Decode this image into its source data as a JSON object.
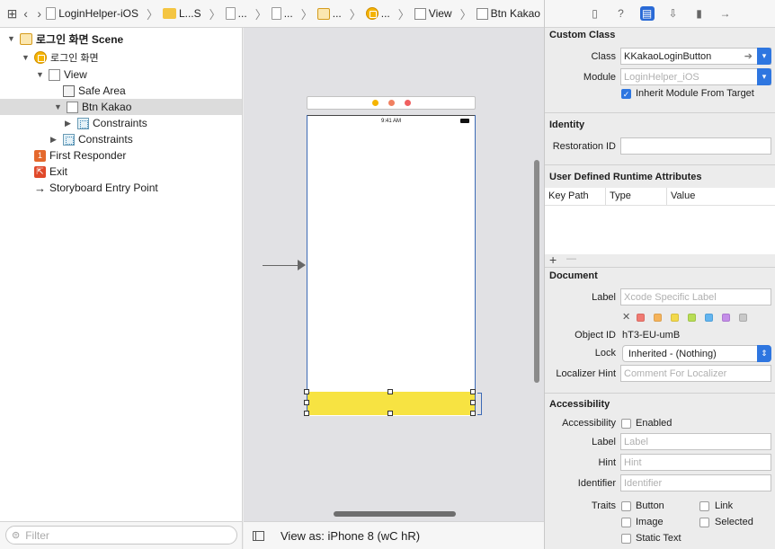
{
  "jumpbar": {
    "items": [
      "LoginHelper-iOS",
      "L...S",
      "...",
      "...",
      "...",
      "...",
      "View",
      "Btn Kakao"
    ]
  },
  "outline": {
    "scene": "로그인 화면 Scene",
    "controller": "로그인 화면",
    "view": "View",
    "safe_area": "Safe Area",
    "btn_kakao": "Btn Kakao",
    "constraints_inner": "Constraints",
    "constraints_outer": "Constraints",
    "first_responder": "First Responder",
    "exit": "Exit",
    "entry_point": "Storyboard Entry Point"
  },
  "filter": {
    "placeholder": "Filter"
  },
  "canvas": {
    "time": "9:41 AM",
    "scene_dot_colors": [
      "#f5b400",
      "#f08060",
      "#f06060"
    ],
    "button_color": "#f7e342"
  },
  "viewas": {
    "label": "View as: iPhone 8",
    "size_class": "(wC hR)"
  },
  "inspector": {
    "custom_class": {
      "title": "Custom Class",
      "class_label": "Class",
      "class_value": "KKakaoLoginButton",
      "module_label": "Module",
      "module_placeholder": "LoginHelper_iOS",
      "inherit_label": "Inherit Module From Target",
      "inherit_checked": true
    },
    "identity": {
      "title": "Identity",
      "restoration_label": "Restoration ID",
      "restoration_value": ""
    },
    "runtime": {
      "title": "User Defined Runtime Attributes",
      "columns": [
        "Key Path",
        "Type",
        "Value"
      ],
      "add": "+",
      "remove": "—"
    },
    "document": {
      "title": "Document",
      "label_label": "Label",
      "label_placeholder": "Xcode Specific Label",
      "swatch_colors": [
        "#f07a72",
        "#f5b35a",
        "#f2d94c",
        "#b8dd55",
        "#63b5f0",
        "#c48ee8",
        "#c8c8c8"
      ],
      "object_id_label": "Object ID",
      "object_id_value": "hT3-EU-umB",
      "lock_label": "Lock",
      "lock_value": "Inherited - (Nothing)",
      "localizer_label": "Localizer Hint",
      "localizer_placeholder": "Comment For Localizer"
    },
    "accessibility": {
      "title": "Accessibility",
      "accessibility_label": "Accessibility",
      "enabled_label": "Enabled",
      "label_label": "Label",
      "label_placeholder": "Label",
      "hint_label": "Hint",
      "hint_placeholder": "Hint",
      "identifier_label": "Identifier",
      "identifier_placeholder": "Identifier",
      "traits_label": "Traits",
      "traits": [
        "Button",
        "Link",
        "Image",
        "Selected",
        "Static Text"
      ]
    }
  }
}
